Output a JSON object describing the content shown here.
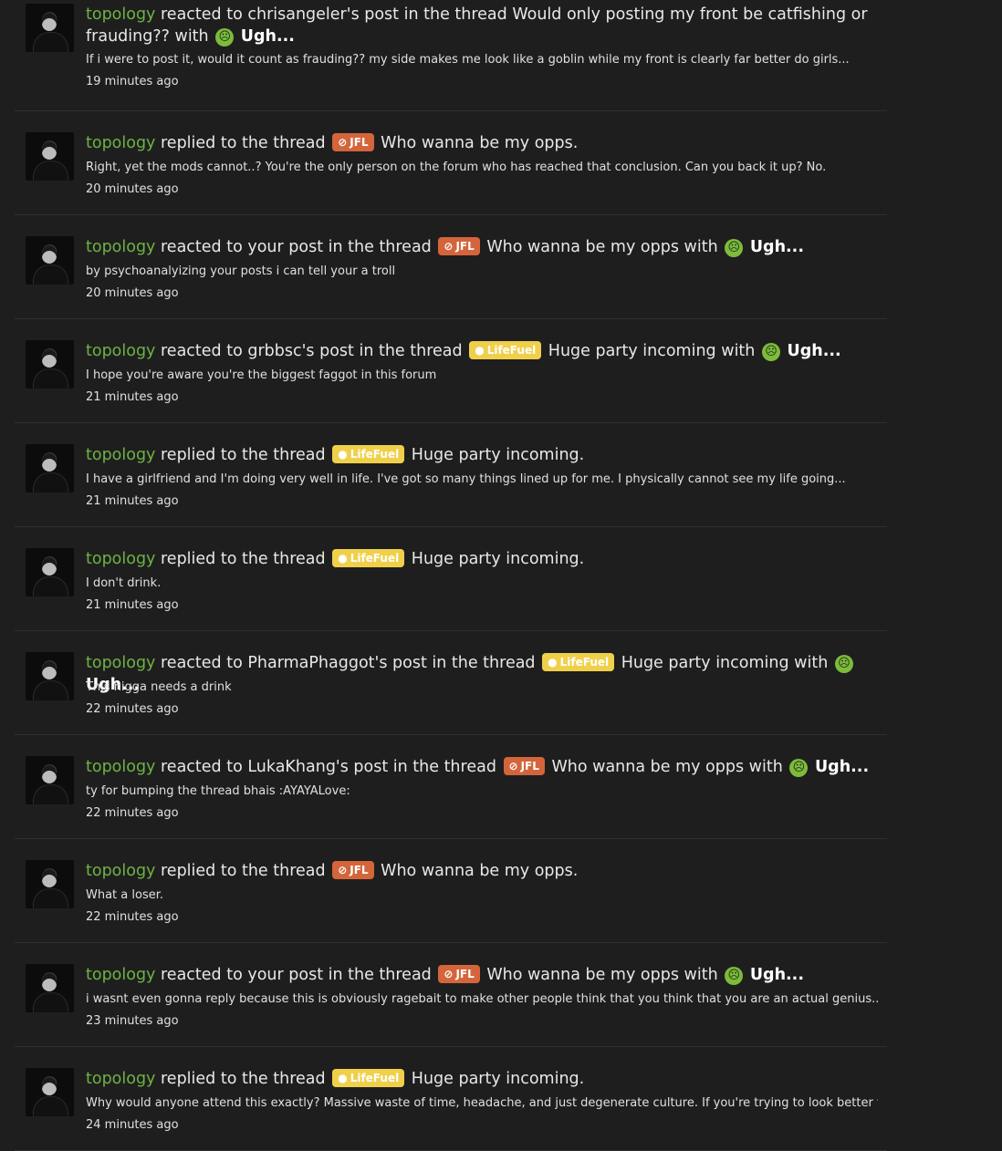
{
  "colors": {
    "background": "#1e1e1f",
    "username": "#6fb243",
    "jfl_badge": "#d4653b",
    "lifefuel_badge": "#f0d04a",
    "reaction": "#7dbb3b"
  },
  "alerts": [
    {
      "user": "topology",
      "action": "reacted to chrisangeler's post in the thread",
      "prefix": "",
      "prefix_icon": "",
      "thread": "Would only posting my front be catfishing or frauding??",
      "with": "with",
      "reaction": "Ugh...",
      "reaction_icon": "angry-face-icon",
      "snippet": "If i were to post it, would it count as frauding?? my side makes me look like a goblin while my front is clearly far better do girls...",
      "time": "19 minutes ago"
    },
    {
      "user": "topology",
      "action": "replied to the thread",
      "prefix": "JFL",
      "prefix_icon": "no-smiling-face-icon",
      "thread": "Who wanna be my opps.",
      "with": "",
      "reaction": "",
      "reaction_icon": "",
      "snippet": "Right, yet the mods cannot..? You're the only person on the forum who has reached that conclusion. Can you back it up? No.",
      "time": "20 minutes ago"
    },
    {
      "user": "topology",
      "action": "reacted to your post in the thread",
      "prefix": "JFL",
      "prefix_icon": "no-smiling-face-icon",
      "thread": "Who wanna be my opps",
      "with": "with",
      "reaction": "Ugh...",
      "reaction_icon": "angry-face-icon",
      "snippet": "by psychoanalyizing your posts i can tell your a troll",
      "time": "20 minutes ago"
    },
    {
      "user": "topology",
      "action": "reacted to grbbsc's post in the thread",
      "prefix": "LifeFuel",
      "prefix_icon": "lightbulb-icon",
      "thread": "Huge party incoming",
      "with": "with",
      "reaction": "Ugh...",
      "reaction_icon": "angry-face-icon",
      "snippet": "I hope you're aware you're the biggest faggot in this forum",
      "time": "21 minutes ago"
    },
    {
      "user": "topology",
      "action": "replied to the thread",
      "prefix": "LifeFuel",
      "prefix_icon": "lightbulb-icon",
      "thread": "Huge party incoming.",
      "with": "",
      "reaction": "",
      "reaction_icon": "",
      "snippet": "I have a girlfriend and I'm doing very well in life. I've got so many things lined up for me. I physically cannot see my life going...",
      "time": "21 minutes ago"
    },
    {
      "user": "topology",
      "action": "replied to the thread",
      "prefix": "LifeFuel",
      "prefix_icon": "lightbulb-icon",
      "thread": "Huge party incoming.",
      "with": "",
      "reaction": "",
      "reaction_icon": "",
      "snippet": "I don't drink.",
      "time": "21 minutes ago"
    },
    {
      "user": "topology",
      "action": "reacted to PharmaPhaggot's post in the thread",
      "prefix": "LifeFuel",
      "prefix_icon": "lightbulb-icon",
      "thread": "Huge party incoming",
      "with": "with",
      "reaction": "Ugh...",
      "reaction_icon": "angry-face-icon",
      "snippet": "This nigga needs a drink",
      "time": "22 minutes ago"
    },
    {
      "user": "topology",
      "action": "reacted to LukaKhang's post in the thread",
      "prefix": "JFL",
      "prefix_icon": "no-smiling-face-icon",
      "thread": "Who wanna be my opps",
      "with": "with",
      "reaction": "Ugh...",
      "reaction_icon": "angry-face-icon",
      "snippet": "ty for bumping the thread bhais :AYAYALove:",
      "time": "22 minutes ago"
    },
    {
      "user": "topology",
      "action": "replied to the thread",
      "prefix": "JFL",
      "prefix_icon": "no-smiling-face-icon",
      "thread": "Who wanna be my opps.",
      "with": "",
      "reaction": "",
      "reaction_icon": "",
      "snippet": "What a loser.",
      "time": "22 minutes ago"
    },
    {
      "user": "topology",
      "action": "reacted to your post in the thread",
      "prefix": "JFL",
      "prefix_icon": "no-smiling-face-icon",
      "thread": "Who wanna be my opps",
      "with": "with",
      "reaction": "Ugh...",
      "reaction_icon": "angry-face-icon",
      "snippet": "i wasnt even gonna reply because this is obviously ragebait to make other people think that you think that you are an actual genius...",
      "time": "23 minutes ago"
    },
    {
      "user": "topology",
      "action": "replied to the thread",
      "prefix": "LifeFuel",
      "prefix_icon": "lightbulb-icon",
      "thread": "Huge party incoming.",
      "with": "",
      "reaction": "",
      "reaction_icon": "",
      "snippet": "Why would anyone attend this exactly? Massive waste of time, headache, and just degenerate culture. If you're trying to look better for...",
      "time": "24 minutes ago"
    }
  ]
}
